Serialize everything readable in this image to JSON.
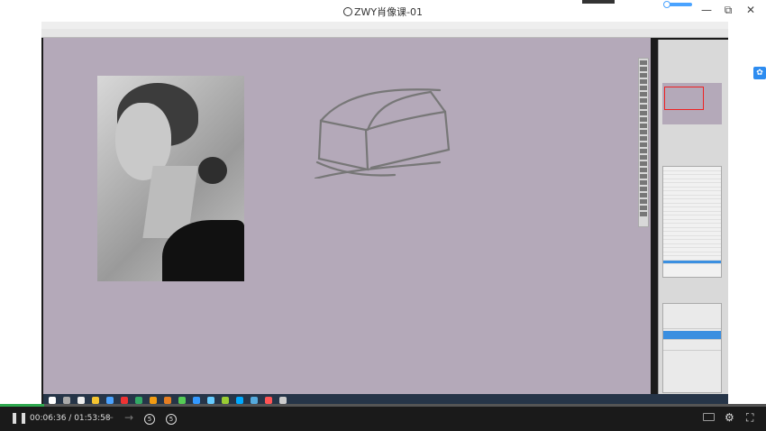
{
  "window": {
    "title": "ZWY肖像课-01",
    "minimize_label": "—",
    "restore_label": "⧉",
    "close_label": "✕"
  },
  "player": {
    "current_time": "00:06:36",
    "duration": "01:53:58",
    "time_separator": " / ",
    "progress": 0.058,
    "accent_color": "#2fa84f",
    "prev_icon": "arrow-left-icon",
    "next_icon": "arrow-right-icon",
    "rewind_label": "5",
    "forward_label": "5"
  },
  "icons": {
    "pause": "pause-icon",
    "subtitle": "subtitle-icon",
    "settings": "gear-icon",
    "fullscreen": "fullscreen-icon",
    "side": "share-icon"
  }
}
